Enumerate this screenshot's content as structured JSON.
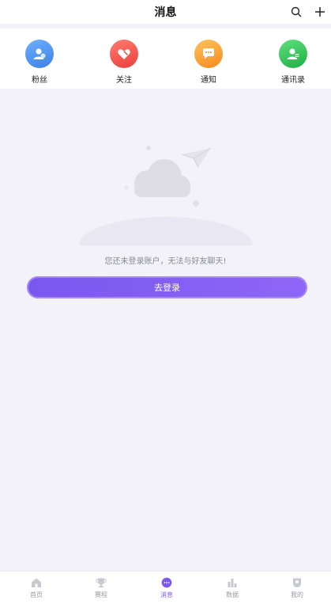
{
  "header": {
    "title": "消息",
    "search_icon": "search-icon",
    "add_icon": "plus-icon"
  },
  "quick_actions": [
    {
      "label": "粉丝",
      "icon": "user-icon",
      "color": "#4a90f2"
    },
    {
      "label": "关注",
      "icon": "heart-icon",
      "color": "#f2554f"
    },
    {
      "label": "通知",
      "icon": "chat-icon",
      "color": "#f5a12d"
    },
    {
      "label": "通讯录",
      "icon": "contacts-icon",
      "color": "#2fc45a"
    }
  ],
  "empty_state": {
    "message": "您还未登录账户，无法与好友聊天!",
    "login_button": "去登录"
  },
  "tabbar": {
    "active": "消息",
    "items": [
      {
        "label": "首页",
        "icon": "home-icon"
      },
      {
        "label": "赛程",
        "icon": "trophy-icon"
      },
      {
        "label": "消息",
        "icon": "message-icon"
      },
      {
        "label": "数据",
        "icon": "chart-icon"
      },
      {
        "label": "我的",
        "icon": "profile-icon"
      }
    ]
  },
  "colors": {
    "accent": "#7b59f1",
    "background": "#f3f2f8"
  }
}
